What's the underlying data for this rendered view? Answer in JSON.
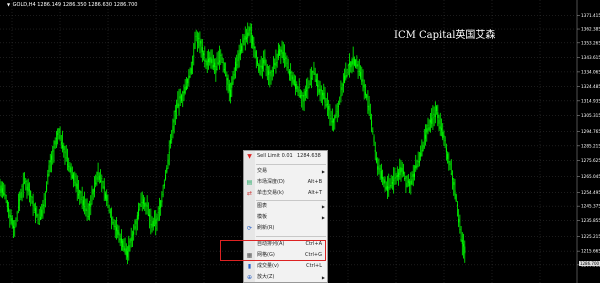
{
  "header": {
    "symbol": "GOLD,H4",
    "ohlc": "1286.149 1286.350 1286.630 1286.700"
  },
  "watermark": "ICM Capital英国艾森",
  "chart_data": {
    "type": "line",
    "ylim": [
      1206.5,
      1377.6
    ],
    "yticks": [
      "1371.415",
      "1362.385",
      "1353.265",
      "1343.615",
      "1334.065",
      "1324.485",
      "1314.935",
      "1305.315",
      "1294.765",
      "1285.215",
      "1275.625",
      "1265.045",
      "1254.495",
      "1245.375",
      "1235.855",
      "1225.215",
      "1215.665",
      "1206.585"
    ],
    "last_price": "1286.700",
    "series": [
      {
        "color": "#00ff00",
        "points": [
          1258,
          1253,
          1240,
          1230,
          1250,
          1262,
          1256,
          1244,
          1236,
          1247,
          1270,
          1283,
          1294,
          1284,
          1272,
          1265,
          1255,
          1248,
          1241,
          1254,
          1268,
          1259,
          1247,
          1236,
          1228,
          1221,
          1214,
          1226,
          1238,
          1251,
          1244,
          1232,
          1236,
          1250,
          1270,
          1292,
          1311,
          1317,
          1324,
          1336,
          1357,
          1352,
          1340,
          1342,
          1336,
          1345,
          1334,
          1320,
          1338,
          1348,
          1356,
          1361,
          1349,
          1334,
          1341,
          1331,
          1338,
          1348,
          1344,
          1333,
          1327,
          1321,
          1316,
          1326,
          1334,
          1321,
          1319,
          1309,
          1301,
          1312,
          1327,
          1336,
          1342,
          1338,
          1328,
          1314,
          1295,
          1271,
          1264,
          1257,
          1261,
          1266,
          1270,
          1260,
          1262,
          1273,
          1281,
          1294,
          1302,
          1309,
          1296,
          1283,
          1268,
          1251,
          1224,
          1214
        ]
      }
    ]
  },
  "menu": {
    "sell_limit": {
      "label": "Sell Limit 0.01",
      "value": "1284.638"
    },
    "items": [
      {
        "label": "交易",
        "shortcut": "",
        "sub": true
      },
      {
        "label": "市场深度(D)",
        "shortcut": "Alt+B"
      },
      {
        "label": "单击交易(k)",
        "shortcut": "Alt+T"
      },
      {
        "label": "图表",
        "shortcut": "",
        "sub": true
      },
      {
        "label": "模板",
        "shortcut": "",
        "sub": true
      },
      {
        "label": "刷新(R)",
        "shortcut": ""
      },
      {
        "label": "自动排列(A)",
        "shortcut": "Ctrl+A"
      },
      {
        "label": "网格(G)",
        "shortcut": "Ctrl+G"
      },
      {
        "label": "成交量(v)",
        "shortcut": "Ctrl+L"
      },
      {
        "label": "放大(Z)",
        "shortcut": ""
      }
    ]
  },
  "colors": {
    "candles": "#00ff00",
    "grid": "#3a3a3a",
    "axis_text": "#ffffff",
    "highlight": "#dd2222"
  }
}
